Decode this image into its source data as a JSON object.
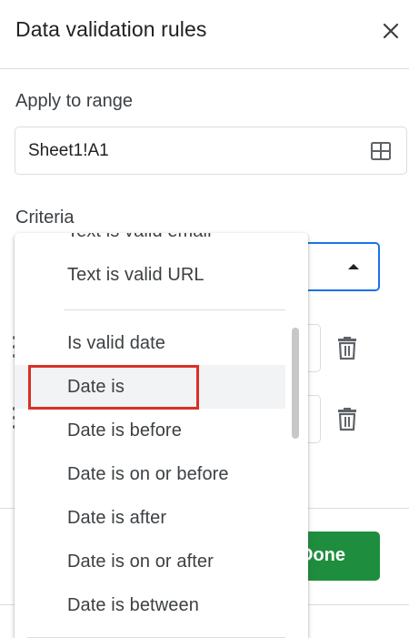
{
  "panel": {
    "title": "Data validation rules",
    "close_icon": "close-icon"
  },
  "apply_range": {
    "label": "Apply to range",
    "value": "Sheet1!A1",
    "icon": "grid-select-icon"
  },
  "criteria": {
    "label": "Criteria"
  },
  "dropdown": {
    "items": [
      {
        "label": "Text is valid email"
      },
      {
        "label": "Text is valid URL"
      },
      {
        "label": "Is valid date"
      },
      {
        "label": "Date is"
      },
      {
        "label": "Date is before"
      },
      {
        "label": "Date is on or before"
      },
      {
        "label": "Date is after"
      },
      {
        "label": "Date is on or after"
      },
      {
        "label": "Date is between"
      }
    ],
    "hovered_item": "Date is"
  },
  "footer": {
    "done_label": "Done"
  },
  "colors": {
    "accent": "#1a73e8",
    "done_button": "#1e8e3e",
    "highlight": "#d93025"
  }
}
